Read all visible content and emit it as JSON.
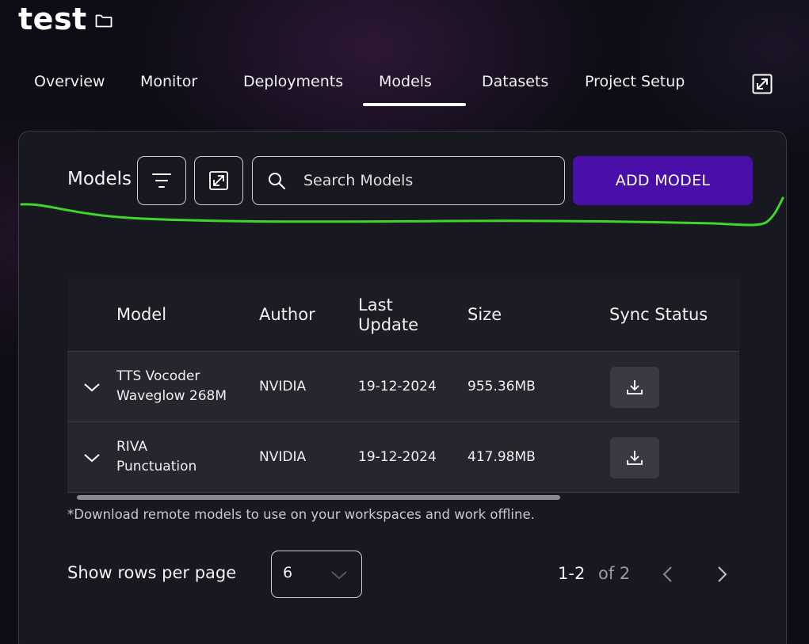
{
  "project": {
    "title": "test",
    "folder_icon": "folder-icon"
  },
  "tabs": [
    {
      "label": "Overview",
      "active": false
    },
    {
      "label": "Monitor",
      "active": false
    },
    {
      "label": "Deployments",
      "active": false
    },
    {
      "label": "Models",
      "active": true
    },
    {
      "label": "Datasets",
      "active": false
    },
    {
      "label": "Project Setup",
      "active": false
    }
  ],
  "toolbar": {
    "title": "Models",
    "filter_icon": "filter-icon",
    "expand_icon": "expand-icon",
    "search_placeholder": "Search Models",
    "add_button": "ADD MODEL"
  },
  "table": {
    "headers": {
      "model": "Model",
      "author": "Author",
      "last_update_1": "Last",
      "last_update_2": "Update",
      "size": "Size",
      "sync": "Sync Status"
    },
    "rows": [
      {
        "model_line1": "TTS Vocoder",
        "model_line2": "Waveglow 268M",
        "author": "NVIDIA",
        "date": "19-12-2024",
        "size": "955.36MB"
      },
      {
        "model_line1": "RIVA",
        "model_line2": "Punctuation",
        "author": "NVIDIA",
        "date": "19-12-2024",
        "size": "417.98MB"
      }
    ],
    "note": "*Download remote models to use on your workspaces and work offline."
  },
  "pagination": {
    "rows_label": "Show rows per page",
    "rows_value": "6",
    "range": "1-2",
    "of": "of 2"
  },
  "colors": {
    "accent": "#4a0fa8",
    "annotation": "#3dd62a",
    "panel": "#181821"
  }
}
